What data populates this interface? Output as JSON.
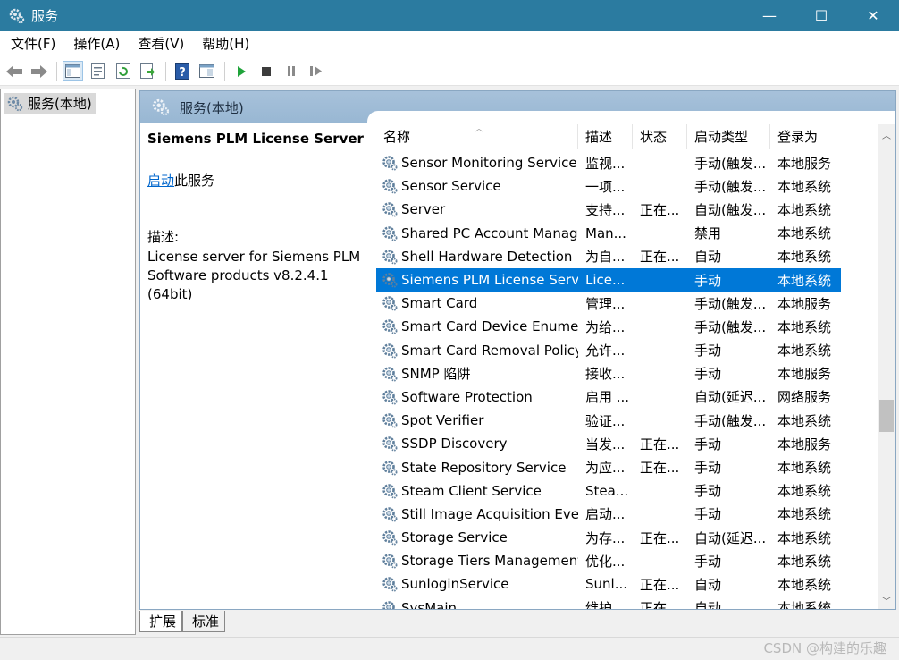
{
  "window": {
    "title": "服务",
    "controls": {
      "minimize": "—",
      "maximize": "☐",
      "close": "✕"
    }
  },
  "menu": [
    "文件(F)",
    "操作(A)",
    "查看(V)",
    "帮助(H)"
  ],
  "toolbar_icons": [
    "back-icon",
    "forward-icon",
    "console-tree-icon",
    "properties-icon",
    "refresh-icon",
    "export-icon",
    "help-icon",
    "show-pane-icon",
    "start-service-icon",
    "stop-service-icon",
    "pause-service-icon",
    "resume-service-icon"
  ],
  "tree": {
    "root_label": "服务(本地)"
  },
  "pane_header": {
    "label": "服务(本地)"
  },
  "details": {
    "service_name": "Siemens PLM License Server",
    "start_link": "启动",
    "start_suffix": "此服务",
    "desc_label": "描述:",
    "desc_line1": "License server for Siemens PLM",
    "desc_line2": "Software products v8.2.4.1 (64bit)"
  },
  "columns": {
    "name": "名称",
    "desc": "描述",
    "status": "状态",
    "startup": "启动类型",
    "logon": "登录为"
  },
  "services": [
    {
      "name": "Sensor Monitoring Service",
      "desc": "监视...",
      "status": "",
      "startup": "手动(触发...",
      "logon": "本地服务"
    },
    {
      "name": "Sensor Service",
      "desc": "一项...",
      "status": "",
      "startup": "手动(触发...",
      "logon": "本地系统"
    },
    {
      "name": "Server",
      "desc": "支持...",
      "status": "正在...",
      "startup": "自动(触发...",
      "logon": "本地系统"
    },
    {
      "name": "Shared PC Account Manager",
      "desc": "Man...",
      "status": "",
      "startup": "禁用",
      "logon": "本地系统"
    },
    {
      "name": "Shell Hardware Detection",
      "desc": "为自...",
      "status": "正在...",
      "startup": "自动",
      "logon": "本地系统"
    },
    {
      "name": "Siemens PLM License Server",
      "desc": "Lice...",
      "status": "",
      "startup": "手动",
      "logon": "本地系统",
      "selected": true
    },
    {
      "name": "Smart Card",
      "desc": "管理...",
      "status": "",
      "startup": "手动(触发...",
      "logon": "本地服务"
    },
    {
      "name": "Smart Card Device Enumer...",
      "desc": "为给...",
      "status": "",
      "startup": "手动(触发...",
      "logon": "本地系统"
    },
    {
      "name": "Smart Card Removal Policy",
      "desc": "允许...",
      "status": "",
      "startup": "手动",
      "logon": "本地系统"
    },
    {
      "name": "SNMP 陷阱",
      "desc": "接收...",
      "status": "",
      "startup": "手动",
      "logon": "本地服务"
    },
    {
      "name": "Software Protection",
      "desc": "启用 ...",
      "status": "",
      "startup": "自动(延迟...",
      "logon": "网络服务"
    },
    {
      "name": "Spot Verifier",
      "desc": "验证...",
      "status": "",
      "startup": "手动(触发...",
      "logon": "本地系统"
    },
    {
      "name": "SSDP Discovery",
      "desc": "当发...",
      "status": "正在...",
      "startup": "手动",
      "logon": "本地服务"
    },
    {
      "name": "State Repository Service",
      "desc": "为应...",
      "status": "正在...",
      "startup": "手动",
      "logon": "本地系统"
    },
    {
      "name": "Steam Client Service",
      "desc": "Stea...",
      "status": "",
      "startup": "手动",
      "logon": "本地系统"
    },
    {
      "name": "Still Image Acquisition Eve...",
      "desc": "启动...",
      "status": "",
      "startup": "手动",
      "logon": "本地系统"
    },
    {
      "name": "Storage Service",
      "desc": "为存...",
      "status": "正在...",
      "startup": "自动(延迟...",
      "logon": "本地系统"
    },
    {
      "name": "Storage Tiers Management",
      "desc": "优化...",
      "status": "",
      "startup": "手动",
      "logon": "本地系统"
    },
    {
      "name": "SunloginService",
      "desc": "Sunl...",
      "status": "正在...",
      "startup": "自动",
      "logon": "本地系统"
    },
    {
      "name": "SysMain",
      "desc": "维护...",
      "status": "正在...",
      "startup": "自动",
      "logon": "本地系统"
    }
  ],
  "tabs": [
    "扩展",
    "标准"
  ],
  "watermark": "CSDN @构建的乐趣",
  "colors": {
    "titlebar": "#2b7ba0",
    "selection": "#0078d7",
    "pane_header": "#a7c1da",
    "link": "#0066cc"
  }
}
